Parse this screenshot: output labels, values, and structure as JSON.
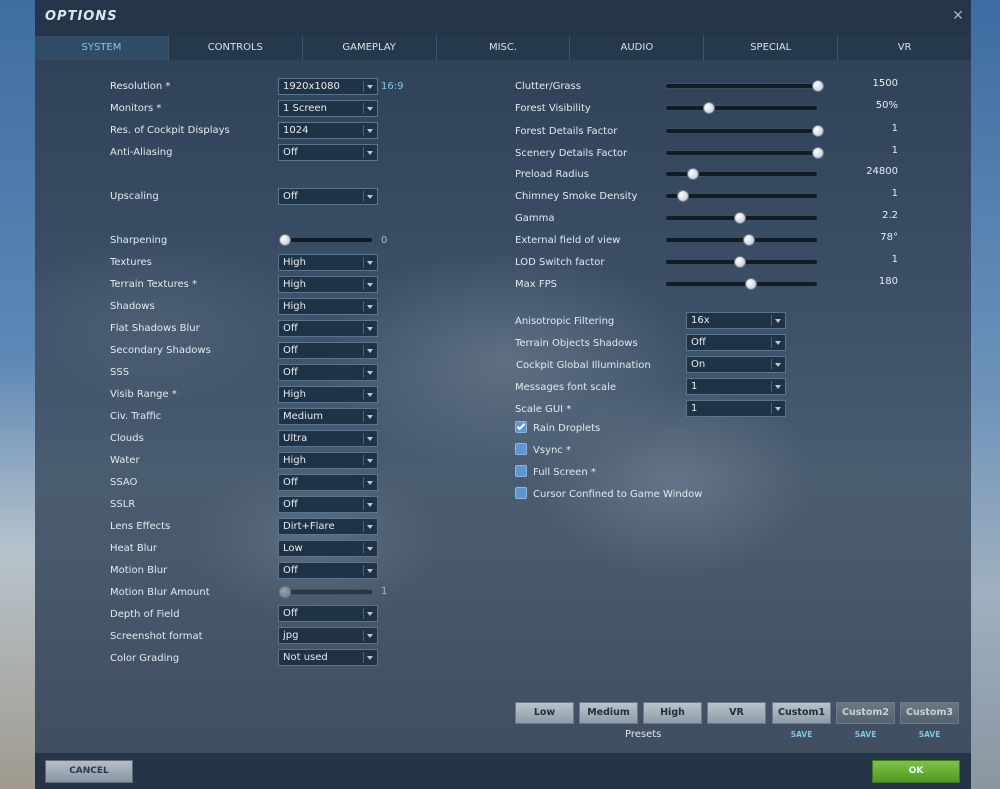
{
  "window": {
    "title": "OPTIONS"
  },
  "tabs": [
    {
      "label": "SYSTEM",
      "active": true
    },
    {
      "label": "CONTROLS"
    },
    {
      "label": "GAMEPLAY"
    },
    {
      "label": "MISC."
    },
    {
      "label": "AUDIO"
    },
    {
      "label": "SPECIAL"
    },
    {
      "label": "VR"
    }
  ],
  "left": {
    "resolution": {
      "label": "Resolution *",
      "value": "1920x1080",
      "aspect": "16:9"
    },
    "monitors": {
      "label": "Monitors *",
      "value": "1 Screen"
    },
    "cockpit_res": {
      "label": "Res. of Cockpit Displays",
      "value": "1024"
    },
    "anti_aliasing": {
      "label": "Anti-Aliasing",
      "value": "Off"
    },
    "upscaling": {
      "label": "Upscaling",
      "value": "Off"
    },
    "sharpening": {
      "label": "Sharpening",
      "value": "0",
      "level": 0
    },
    "textures": {
      "label": "Textures",
      "value": "High"
    },
    "terrain_textures": {
      "label": "Terrain Textures *",
      "value": "High"
    },
    "shadows": {
      "label": "Shadows",
      "value": "High"
    },
    "flat_shadows_blur": {
      "label": "Flat Shadows Blur",
      "value": "Off"
    },
    "secondary_shadows": {
      "label": "Secondary Shadows",
      "value": "Off"
    },
    "sss": {
      "label": "SSS",
      "value": "Off"
    },
    "visib_range": {
      "label": "Visib Range *",
      "value": "High"
    },
    "civ_traffic": {
      "label": "Civ. Traffic",
      "value": "Medium"
    },
    "clouds": {
      "label": "Clouds",
      "value": "Ultra"
    },
    "water": {
      "label": "Water",
      "value": "High"
    },
    "ssao": {
      "label": "SSAO",
      "value": "Off"
    },
    "sslr": {
      "label": "SSLR",
      "value": "Off"
    },
    "lens_effects": {
      "label": "Lens Effects",
      "value": "Dirt+Flare"
    },
    "heat_blur": {
      "label": "Heat Blur",
      "value": "Low"
    },
    "motion_blur": {
      "label": "Motion Blur",
      "value": "Off"
    },
    "motion_blur_amount": {
      "label": "Motion Blur Amount",
      "value": "1",
      "level": 0
    },
    "depth_of_field": {
      "label": "Depth of Field",
      "value": "Off"
    },
    "screenshot_format": {
      "label": "Screenshot format",
      "value": "jpg"
    },
    "color_grading": {
      "label": "Color Grading",
      "value": "Not used"
    }
  },
  "right": {
    "sliders": [
      {
        "label": "Clutter/Grass",
        "value": "1500",
        "level": 1.0
      },
      {
        "label": "Forest Visibility",
        "value": "50%",
        "level": 0.29
      },
      {
        "label": "Forest Details Factor",
        "value": "1",
        "level": 1.0
      },
      {
        "label": "Scenery Details Factor",
        "value": "1",
        "level": 1.0
      },
      {
        "label": "Preload Radius",
        "value": "24800",
        "level": 0.18
      },
      {
        "label": "Chimney Smoke Density",
        "value": "1",
        "level": 0.12
      },
      {
        "label": "Gamma",
        "value": "2.2",
        "level": 0.49
      },
      {
        "label": "External field of view",
        "value": "78°",
        "level": 0.55
      },
      {
        "label": "LOD Switch factor",
        "value": "1",
        "level": 0.49
      },
      {
        "label": "Max FPS",
        "value": "180",
        "level": 0.56
      }
    ],
    "anisotropic": {
      "label": "Anisotropic Filtering",
      "value": "16x"
    },
    "terrain_obj_shadows": {
      "label": "Terrain Objects Shadows",
      "value": "Off"
    },
    "cockpit_gi": {
      "label": "Cockpit Global Illumination",
      "value": "On"
    },
    "msg_font_scale": {
      "label": "Messages font scale",
      "value": "1"
    },
    "scale_gui": {
      "label": "Scale GUI *",
      "value": "1"
    },
    "checkboxes": [
      {
        "label": "Rain Droplets",
        "checked": true
      },
      {
        "label": "Vsync *",
        "checked": false
      },
      {
        "label": "Full Screen *",
        "checked": false
      },
      {
        "label": "Cursor Confined to Game Window",
        "checked": false
      }
    ]
  },
  "presets": {
    "label": "Presets",
    "buttons": [
      "Low",
      "Medium",
      "High",
      "VR",
      "Custom1",
      "Custom2",
      "Custom3"
    ],
    "save_label": "SAVE"
  },
  "footer": {
    "cancel": "CANCEL",
    "ok": "OK"
  },
  "colors": {
    "accent": "#7fc6e8",
    "ok_green": "#5fa82e",
    "checkbox_blue": "#5f96cf"
  }
}
